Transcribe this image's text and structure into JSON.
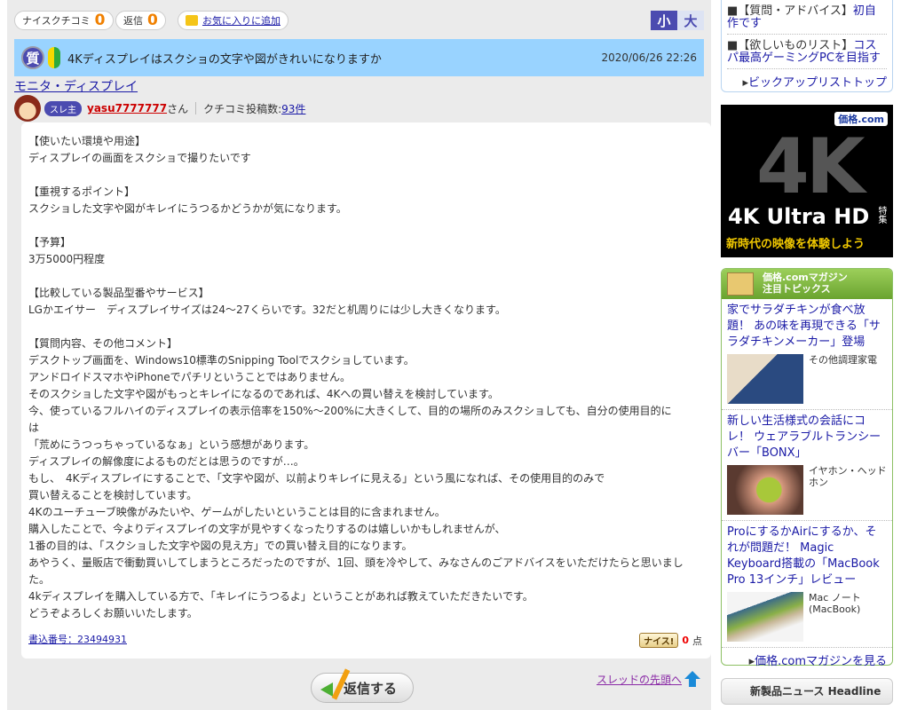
{
  "toolbar": {
    "nice_label": "ナイスクチコミ",
    "nice_count": "0",
    "reply_label": "返信",
    "reply_count": "0",
    "favorite": "お気に入りに追加",
    "size_small": "小",
    "size_large": "大"
  },
  "thread": {
    "badge": "質",
    "title": "4Kディスプレイはスクショの文字や図がきれいになりますか",
    "date": "2020/06/26 22:26",
    "category": "モニタ・ディスプレイ"
  },
  "user": {
    "badge": "スレ主",
    "name": "yasu7777777",
    "suffix": "さん",
    "posts_label": "クチコミ投稿数:",
    "posts": "93件"
  },
  "post": {
    "lines": [
      "【使いたい環境や用途】",
      "ディスプレイの画面をスクショで撮りたいです",
      "",
      "【重視するポイント】",
      "スクショした文字や図がキレイにうつるかどうかが気になります。",
      "",
      "【予算】",
      "3万5000円程度",
      "",
      "【比較している製品型番やサービス】",
      "LGかエイサー　ディスプレイサイズは24〜27くらいです。32だと机周りには少し大きくなります。",
      "",
      "【質問内容、その他コメント】",
      "デスクトップ画面を、Windows10標準のSnipping Toolでスクショしています。",
      "アンドロイドスマホやiPhoneでパチリということではありません。",
      "そのスクショした文字や図がもっとキレイになるのであれば、4Kへの買い替えを検討しています。",
      "今、使っているフルハイのディスプレイの表示倍率を150%〜200%に大きくして、目的の場所のみスクショしても、自分の使用目的に",
      "は",
      "「荒めにうつっちゃっているなぁ」という感想があります。",
      "ディスプレイの解像度によるものだとは思うのですが…。",
      "もし、　4Kディスプレイにすることで、「文字や図が、以前よりキレイに見える」という風になれば、その使用目的のみで",
      "買い替えることを検討しています。",
      "4Kのユーチューブ映像がみたいや、ゲームがしたいということは目的に含まれません。",
      "購入したことで、今よりディスプレイの文字が見やすくなったりするのは嬉しいかもしれませんが、",
      "1番の目的は、「スクショした文字や図の見え方」での買い替え目的になります。",
      "あやうく、量販店で衝動買いしてしまうところだったのですが、1回、頭を冷やして、みなさんのごアドバイスをいただけたらと思いまし",
      "た。",
      "4kディスプレイを購入している方で、「キレイにうつるよ」ということがあれば教えていただきたいです。",
      "どうぞよろしくお願いいたします。"
    ],
    "number": "書込番号：23494931",
    "nice_button": "ナイス!",
    "nice_points": "0",
    "points_unit": "点"
  },
  "actions": {
    "reply": "返信する",
    "to_top": "スレッドの先頭へ"
  },
  "sidebar": {
    "pickup": [
      {
        "tag": "【質問・アドバイス】",
        "title": "初自作です"
      },
      {
        "tag": "【欲しいものリスト】",
        "title": "コスパ最高ゲーミングPCを目指す"
      }
    ],
    "pickup_more": "ビックアップリストトップ",
    "banner": {
      "logo": "価格.com",
      "big": "4K",
      "headline": "4K Ultra HD",
      "tag": "特集",
      "sub": "新時代の映像を体験しよう"
    },
    "magazine": {
      "title1": "価格.comマガジン",
      "title2": "注目トピックス",
      "articles": [
        {
          "title": "家でサラダチキンが食べ放題！ あの味を再現できる「サラダチキンメーカー」登場",
          "category": "その他調理家電"
        },
        {
          "title": "新しい生活様式の会話にコレ！ ウェアラブルトランシーバー「BONX」",
          "category": "イヤホン・ヘッドホン"
        },
        {
          "title": "ProにするかAirにするか、それが問題だ！ Magic Keyboard搭載の「MacBook Pro 13インチ」レビュー",
          "category": "Mac ノート(MacBook)"
        }
      ],
      "more": "価格.comマガジンを見る"
    },
    "news": "新製品ニュース Headline"
  },
  "colors": {
    "title_bar": "#99d3ff",
    "accent": "#f08000",
    "link": "#1a1aa6"
  }
}
